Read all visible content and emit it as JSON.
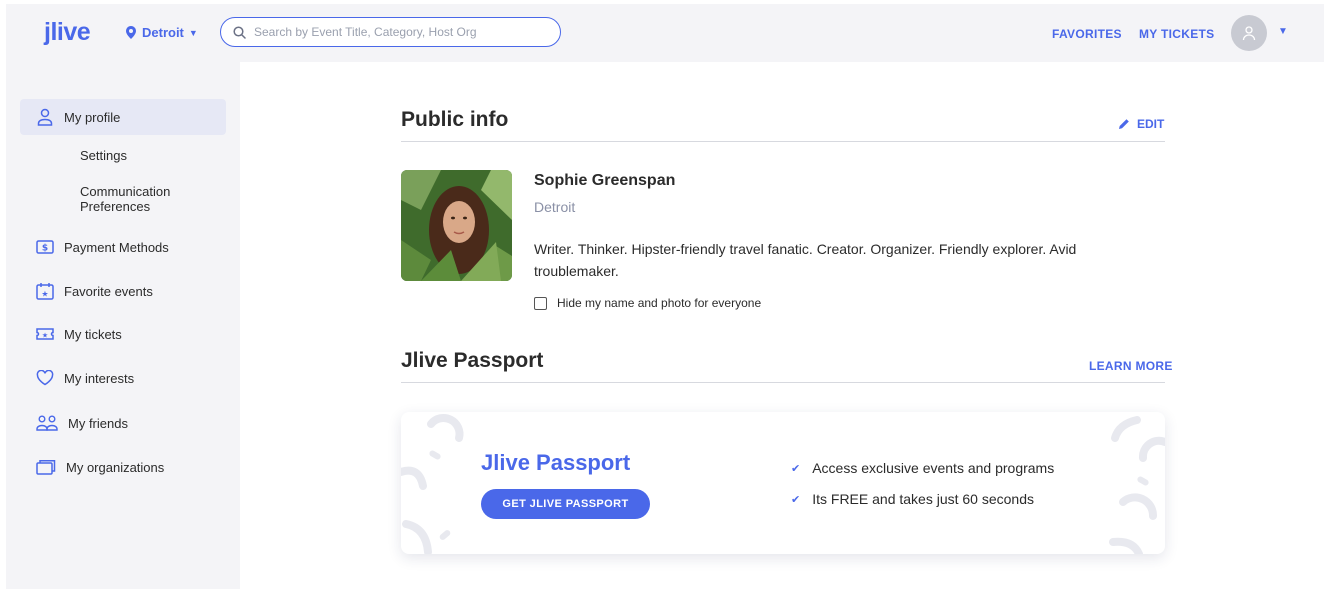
{
  "header": {
    "logo": "jlive",
    "location": "Detroit",
    "search_placeholder": "Search by Event Title, Category, Host Org",
    "favorites_label": "FAVORITES",
    "my_tickets_label": "MY TICKETS"
  },
  "sidebar": {
    "my_profile": "My profile",
    "settings": "Settings",
    "communication_line1": "Communication",
    "communication_line2": "Preferences",
    "payment_methods": "Payment Methods",
    "favorite_events": "Favorite events",
    "my_tickets": "My tickets",
    "my_interests": "My interests",
    "my_friends": "My friends",
    "my_organizations": "My organizations"
  },
  "public_info": {
    "title": "Public info",
    "edit_label": "EDIT",
    "name": "Sophie Greenspan",
    "city": "Detroit",
    "bio": "Writer. Thinker. Hipster-friendly travel fanatic. Creator. Organizer. Friendly explorer. Avid troublemaker.",
    "hide_label": "Hide my name and photo for everyone"
  },
  "passport": {
    "section_title": "Jlive Passport",
    "learn_more_label": "LEARN MORE",
    "card_title": "Jlive Passport",
    "button_label": "GET JLIVE PASSPORT",
    "features": [
      "Access exclusive events and programs",
      "Its FREE and takes just 60 seconds"
    ]
  },
  "colors": {
    "accent": "#4a68e9",
    "sidebar_bg": "#f4f4f7",
    "active_item_bg": "#e6e8f5"
  },
  "icons": [
    "location-pin-icon",
    "search-icon",
    "user-icon",
    "chevron-down-icon",
    "dollar-icon",
    "calendar-star-icon",
    "ticket-icon",
    "heart-icon",
    "friends-icon",
    "folder-icon",
    "pencil-icon",
    "check-icon"
  ]
}
